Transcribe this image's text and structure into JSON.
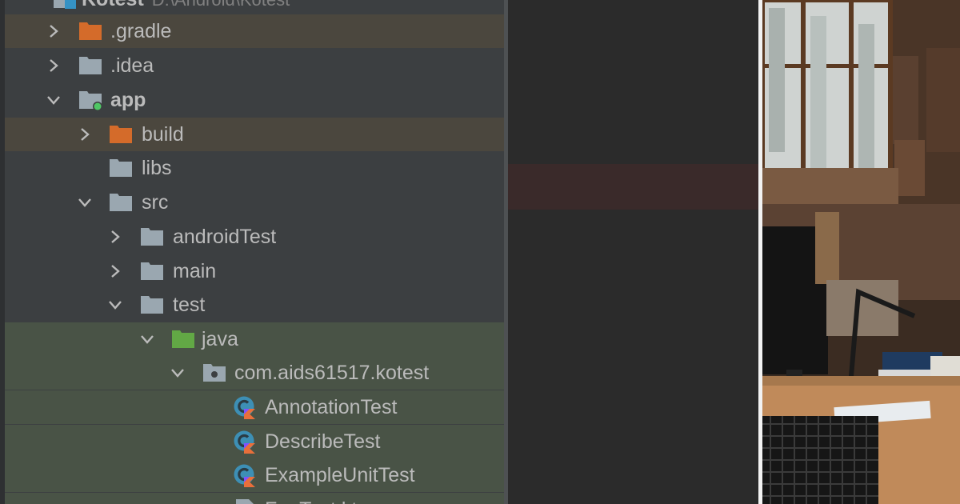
{
  "project_view": {
    "root": {
      "name": "Kotest",
      "path": "D:\\Android\\Kotest"
    },
    "items": [
      {
        "label": ".gradle"
      },
      {
        "label": ".idea"
      },
      {
        "label": "app"
      },
      {
        "label": "build"
      },
      {
        "label": "libs"
      },
      {
        "label": "src"
      },
      {
        "label": "androidTest"
      },
      {
        "label": "main"
      },
      {
        "label": "test"
      },
      {
        "label": "java"
      },
      {
        "label": "com.aids61517.kotest"
      },
      {
        "label": "AnnotationTest"
      },
      {
        "label": "DescribeTest"
      },
      {
        "label": "ExampleUnitTest"
      },
      {
        "label": "FunTest.kt"
      }
    ]
  },
  "colors": {
    "tree_bg": "#3c3f41",
    "excluded_row": "#4b473e",
    "test_row": "#495346",
    "folder_gray": "#9aa7b0",
    "folder_orange": "#d46b2a",
    "folder_green": "#62a845",
    "kotlin_class": "#3d8fb5"
  },
  "icons": [
    "folder-icon",
    "excluded-folder-icon",
    "module-folder-icon",
    "test-source-folder-icon",
    "package-icon",
    "kotlin-class-icon",
    "chevron-right-icon",
    "chevron-down-icon"
  ]
}
